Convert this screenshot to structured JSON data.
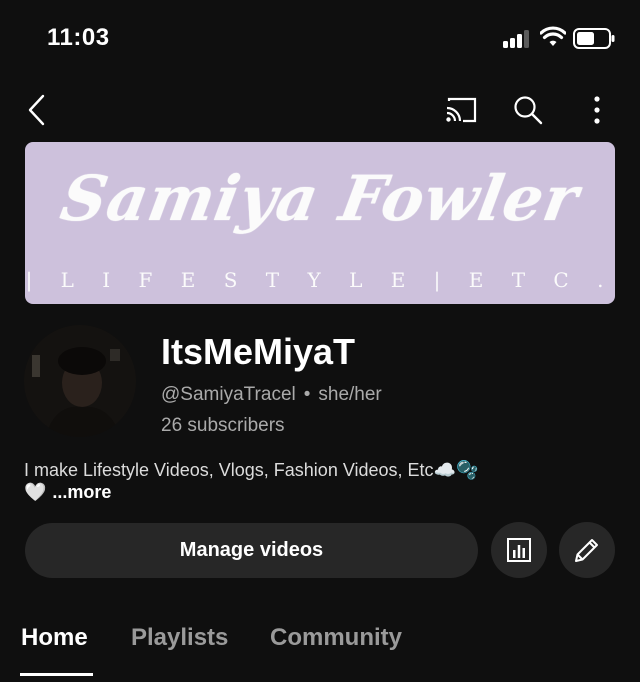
{
  "status_bar": {
    "time": "11:03",
    "icons": [
      "cellular-signal-icon",
      "wifi-icon",
      "battery-icon"
    ]
  },
  "top_nav": {
    "icons": [
      "back-arrow-icon",
      "cast-icon",
      "search-icon",
      "more-vertical-icon"
    ]
  },
  "banner": {
    "title": "Samiya Fowler",
    "subtitle": "| L I F E S T Y L E | E T C .",
    "background_color": "#cdc1dc"
  },
  "channel": {
    "name": "ItsMeMiyaT",
    "handle": "@SamiyaTracel",
    "separator": "•",
    "pronouns": "she/her",
    "subscribers": "26 subscribers",
    "description": "I make Lifestyle Videos, Vlogs, Fashion Videos, Etc☁️🫧",
    "description_line2": "🤍",
    "more_label": "...more"
  },
  "actions": {
    "manage_label": "Manage videos",
    "icons": [
      "analytics-icon",
      "edit-pencil-icon"
    ]
  },
  "tabs": [
    "Home",
    "Playlists",
    "Community"
  ],
  "active_tab": "Home"
}
